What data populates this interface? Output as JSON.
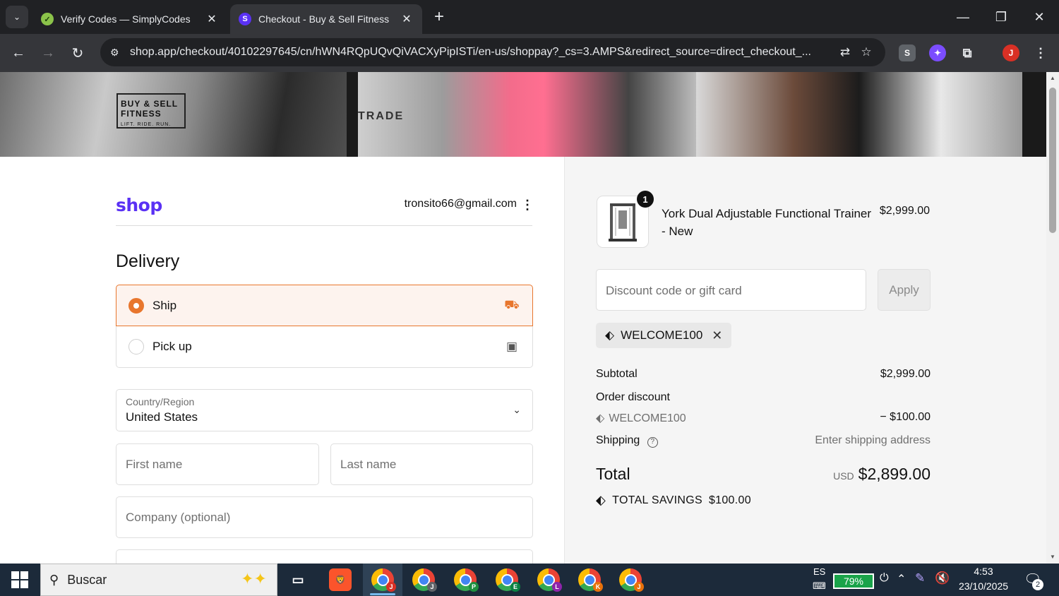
{
  "browser": {
    "tabs": [
      {
        "title": "Verify Codes — SimplyCodes",
        "active": false
      },
      {
        "title": "Checkout - Buy & Sell Fitness",
        "active": true
      }
    ],
    "url": "shop.app/checkout/40102297645/cn/hWN4RQpUQvQiVACXyPipISTi/en-us/shoppay?_cs=3.AMPS&redirect_source=direct_checkout_...",
    "profile_initial": "J",
    "extension_s": "S"
  },
  "banner": {
    "logo_text": "BUY & SELL FITNESS",
    "logo_sub": "LIFT. RIDE. RUN.",
    "tag_trade": "TRADE"
  },
  "checkout": {
    "brand": "shop",
    "account_email": "tronsito66@gmail.com",
    "delivery_title": "Delivery",
    "options": [
      {
        "label": "Ship",
        "selected": true,
        "icon": "truck-icon"
      },
      {
        "label": "Pick up",
        "selected": false,
        "icon": "store-icon"
      }
    ],
    "country_label": "Country/Region",
    "country_value": "United States",
    "first_name_placeholder": "First name",
    "last_name_placeholder": "Last name",
    "company_placeholder": "Company (optional)"
  },
  "summary": {
    "product_name": "York Dual Adjustable Functional Trainer - New",
    "product_price": "$2,999.00",
    "quantity": "1",
    "discount_placeholder": "Discount code or gift card",
    "apply_label": "Apply",
    "applied_code": "WELCOME100",
    "subtotal_label": "Subtotal",
    "subtotal_value": "$2,999.00",
    "order_discount_label": "Order discount",
    "discount_code": "WELCOME100",
    "discount_value": "− $100.00",
    "shipping_label": "Shipping",
    "shipping_value": "Enter shipping address",
    "total_label": "Total",
    "total_currency": "USD",
    "total_value": "$2,899.00",
    "savings_label": "TOTAL SAVINGS",
    "savings_value": "$100.00"
  },
  "taskbar": {
    "search_placeholder": "Buscar",
    "language": "ES",
    "battery": "79%",
    "time": "4:53",
    "date": "23/10/2025",
    "notifications": "2",
    "chrome_profiles": [
      "J",
      "J",
      "P",
      "E",
      "L",
      "K",
      "J"
    ]
  },
  "colors": {
    "accent_orange": "#e8762d",
    "shop_purple": "#5a31f4"
  }
}
